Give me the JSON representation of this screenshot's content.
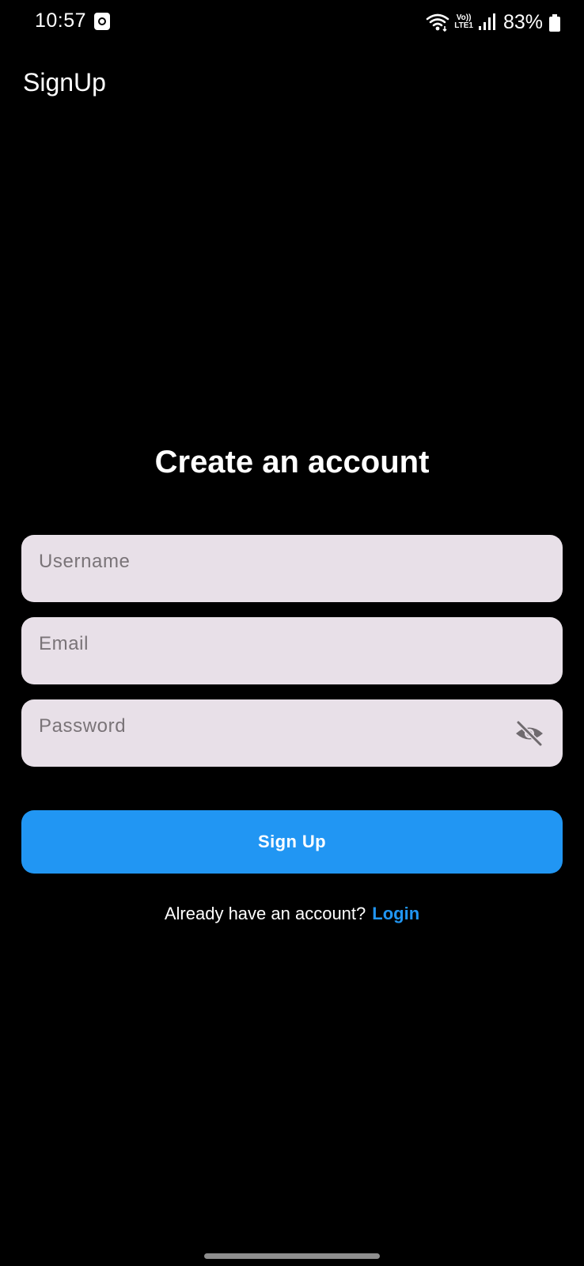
{
  "status_bar": {
    "time": "10:57",
    "lte_top": "Vo))",
    "lte_bottom": "LTE1",
    "battery": "83%"
  },
  "app_bar": {
    "title": "SignUp"
  },
  "main": {
    "headline": "Create an account",
    "fields": {
      "username_placeholder": "Username",
      "email_placeholder": "Email",
      "password_placeholder": "Password"
    },
    "signup_button": "Sign Up",
    "login_prompt": "Already have an account?",
    "login_link": "Login"
  },
  "colors": {
    "background": "#000000",
    "field_fill": "#e8e0e8",
    "primary": "#2196f3"
  },
  "icons": {
    "password_toggle": "visibility-off-icon"
  }
}
